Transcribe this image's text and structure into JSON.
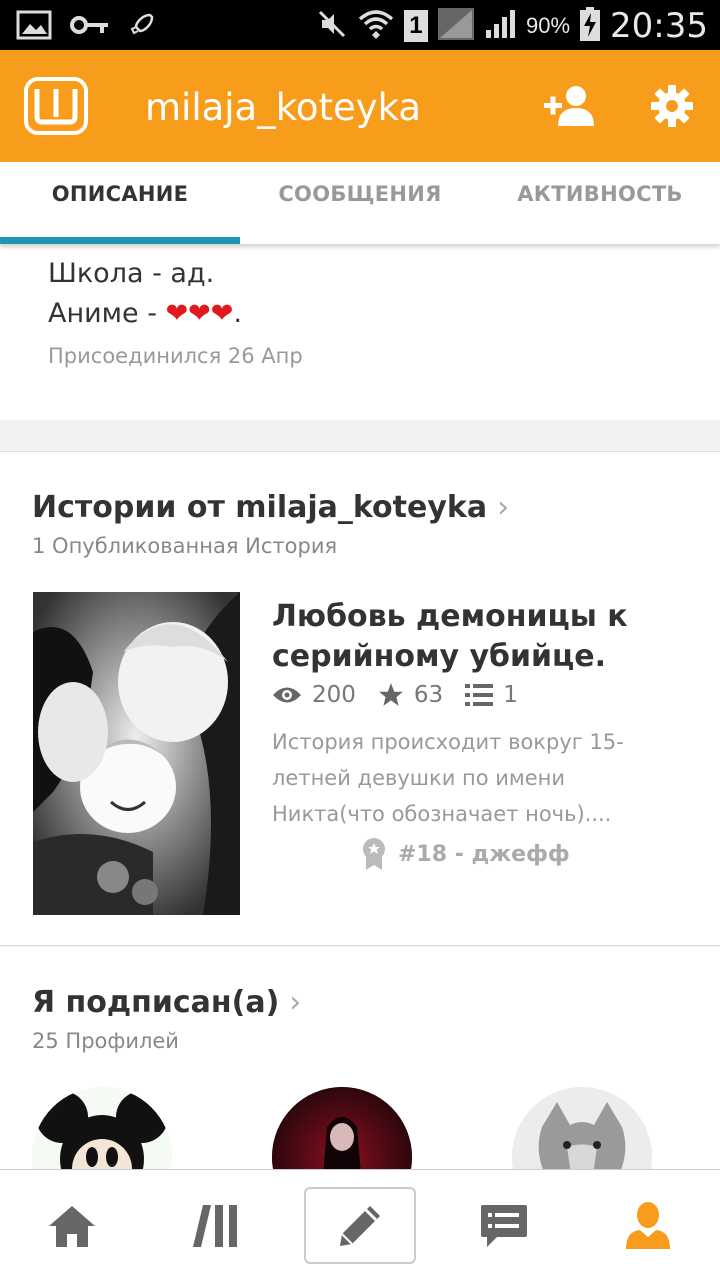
{
  "status_bar": {
    "battery_percent": "90%",
    "time": "20:35",
    "sim_slot": "1",
    "icons": [
      "image-icon",
      "key-icon",
      "rocket-icon",
      "mute-icon",
      "wifi-icon",
      "sim-icon",
      "signal-icon",
      "battery-charging-icon"
    ]
  },
  "app_bar": {
    "username": "milaja_koteyka",
    "logo_letter": "Ш",
    "color": "#f89d1b"
  },
  "tabs": [
    {
      "label": "ОПИСАНИЕ",
      "active": true
    },
    {
      "label": "СООБЩЕНИЯ",
      "active": false
    },
    {
      "label": "АКТИВНОСТЬ",
      "active": false
    }
  ],
  "about": {
    "line1": "Школа - ад.",
    "line2_prefix": "Аниме - ",
    "line2_suffix": ".",
    "hearts": "❤❤❤",
    "joined": "Присоединился 26 Апр"
  },
  "stories": {
    "title": "Истории от milaja_koteyka",
    "subtitle": "1 Опубликованная История",
    "items": [
      {
        "title": "Любовь демоницы к серийному убийце.",
        "reads": "200",
        "votes": "63",
        "parts": "1",
        "description": "История происходит вокруг 15-летней девушки по имени Никта(что обозначает ночь)....",
        "rank": "#18 - джефф"
      }
    ]
  },
  "following": {
    "title": "Я подписан(а)",
    "subtitle": "25 Профилей"
  },
  "bottom_nav": {
    "items": [
      "home-icon",
      "library-icon",
      "write-icon",
      "messages-icon",
      "profile-icon"
    ],
    "active_color": "#f89d1b"
  }
}
